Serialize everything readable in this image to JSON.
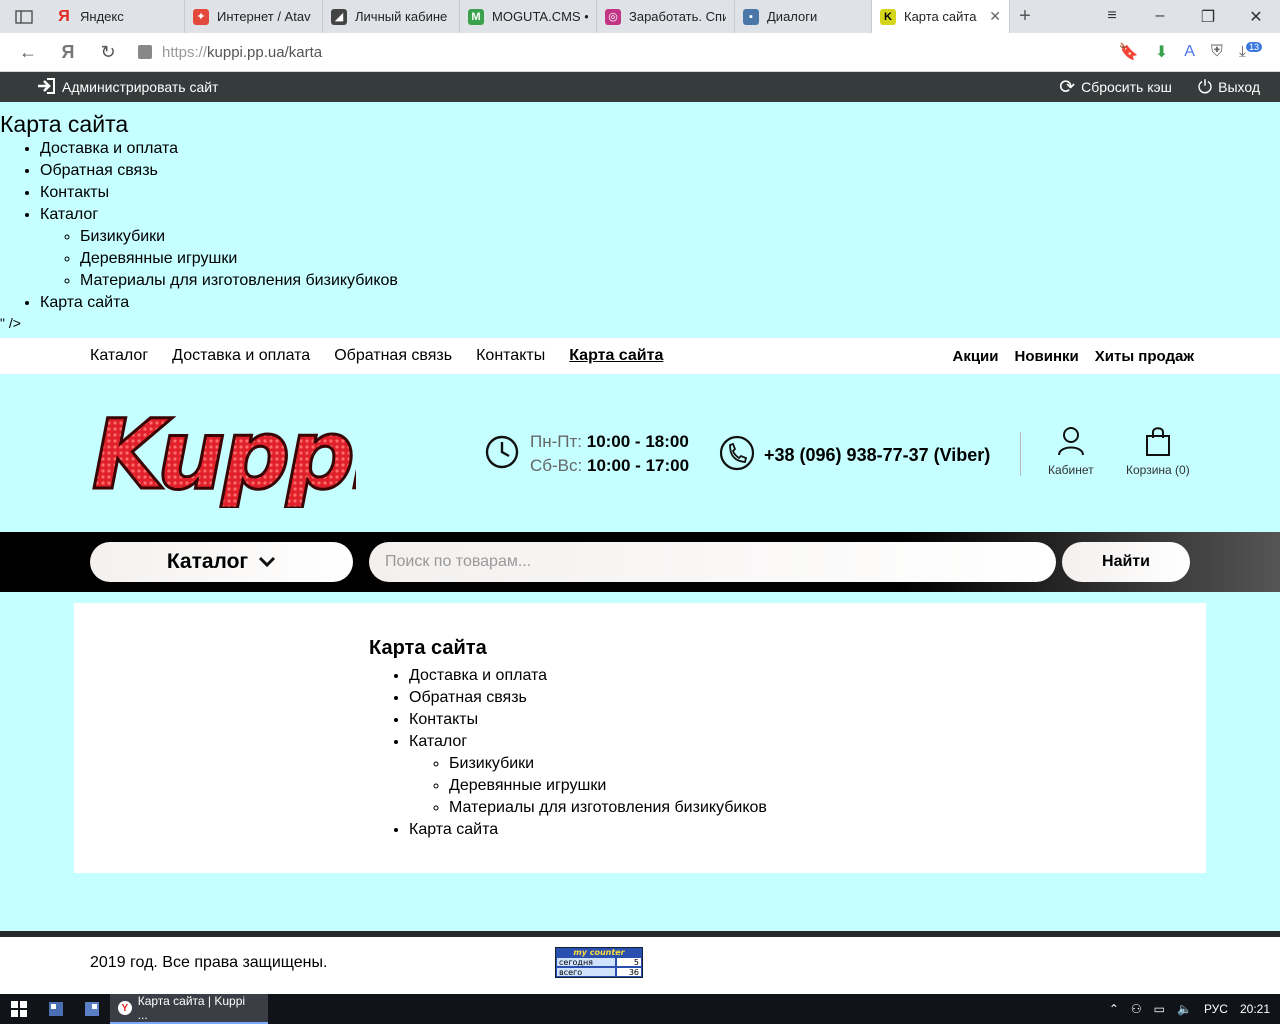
{
  "browser": {
    "tabs": [
      {
        "label": "Яндекс",
        "icon": "yandex-icon",
        "color": "#e52620"
      },
      {
        "label": "Интернет / Atav",
        "icon": "shield-icon",
        "color": "#e3493b"
      },
      {
        "label": "Личный кабине",
        "icon": "account-icon",
        "color": "#444444"
      },
      {
        "label": "MOGUTA.CMS •",
        "icon": "moguta-icon",
        "color": "#3aa24a"
      },
      {
        "label": "Заработать. Спи",
        "icon": "instagram-icon",
        "color": "#c13584"
      },
      {
        "label": "Диалоги",
        "icon": "chat-icon",
        "color": "#4a76a8"
      },
      {
        "label": "Карта сайта |",
        "icon": "kuppi-icon",
        "color": "#d4d41a"
      }
    ],
    "url_scheme": "https://",
    "url_rest": "kuppi.pp.ua/karta",
    "downloads_badge": "13"
  },
  "adminbar": {
    "admin_label": "Администрировать сайт",
    "cache_label": "Сбросить кэш",
    "logout_label": "Выход"
  },
  "top_sitemap": {
    "title": "Карта сайта",
    "items": [
      "Доставка и оплата",
      "Обратная связь",
      "Контакты",
      "Каталог"
    ],
    "sub_items": [
      "Бизикубики",
      "Деревянные игрушки",
      "Материалы для изготовления бизикубиков"
    ],
    "last_item": "Карта сайта",
    "stray_text": "\" />"
  },
  "topnav": {
    "left": [
      "Каталог",
      "Доставка и оплата",
      "Обратная связь",
      "Контакты"
    ],
    "active": "Карта сайта",
    "right": [
      "Акции",
      "Новинки",
      "Хиты продаж"
    ]
  },
  "header": {
    "logo_text": "Kuppi",
    "weekday_label": "Пн-Пт:",
    "weekday_hours": "10:00 - 18:00",
    "weekend_label": "Сб-Вс:",
    "weekend_hours": "10:00 - 17:00",
    "phone": "+38 (096) 938-77-37 (Viber)",
    "cabinet_label": "Кабинет",
    "cart_label": "Корзина (0)"
  },
  "search": {
    "catalog_label": "Каталог",
    "placeholder": "Поиск по товарам...",
    "button_label": "Найти"
  },
  "main_sitemap": {
    "title": "Карта сайта",
    "items": [
      "Доставка и оплата",
      "Обратная связь",
      "Контакты",
      "Каталог"
    ],
    "sub_items": [
      "Бизикубики",
      "Деревянные игрушки",
      "Материалы для изготовления бизикубиков"
    ],
    "last_item": "Карта сайта"
  },
  "footer": {
    "copyright": "2019 год. Все права защищены.",
    "counter_title": "my counter",
    "counter_today_label": "сегодня",
    "counter_today_value": "5",
    "counter_total_label": "всего",
    "counter_total_value": "36"
  },
  "taskbar": {
    "task_label": "Карта сайта | Kuppi ...",
    "lang": "РУС",
    "time": "20:21"
  },
  "colors": {
    "page_bg": "#c5ffff",
    "adminbar_bg": "#363b3c",
    "logo_red": "#e0202a"
  }
}
